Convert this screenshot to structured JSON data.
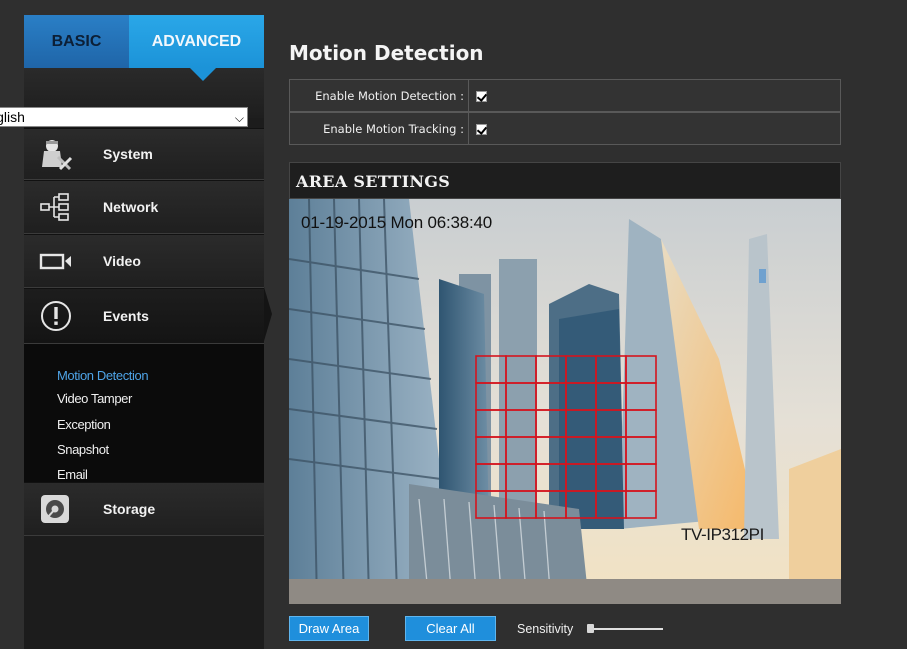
{
  "nav": {
    "tabs": [
      {
        "label": "BASIC",
        "selected": false
      },
      {
        "label": "ADVANCED",
        "selected": true
      }
    ],
    "language": "English",
    "menu": [
      {
        "key": "system",
        "label": "System",
        "icon": "user-tools-icon"
      },
      {
        "key": "network",
        "label": "Network",
        "icon": "network-tree-icon"
      },
      {
        "key": "video",
        "label": "Video",
        "icon": "video-camera-icon"
      },
      {
        "key": "events",
        "label": "Events",
        "icon": "exclamation-circle-icon",
        "expanded": true
      },
      {
        "key": "storage",
        "label": "Storage",
        "icon": "disk-icon"
      }
    ],
    "events_submenu": [
      "Motion Detection",
      "Video Tamper",
      "Exception",
      "Snapshot",
      "Email"
    ],
    "events_submenu_active": "Motion Detection"
  },
  "main": {
    "title": "Motion Detection",
    "options": [
      {
        "label": "Enable Motion Detection :",
        "checked": true
      },
      {
        "label": "Enable Motion Tracking :",
        "checked": true
      }
    ],
    "area_settings": {
      "title": "AREA SETTINGS",
      "osd_timestamp": "01-19-2015 Mon  06:38:40",
      "osd_camera_name": "TV-IP312PI",
      "grid": {
        "columns": 6,
        "rows": 6,
        "color": "#d4141e"
      }
    },
    "buttons": {
      "draw_area": "Draw Area",
      "clear_all": "Clear All"
    },
    "sensitivity": {
      "label": "Sensitivity",
      "level": 0.0
    }
  },
  "colors": {
    "accent_blue": "#1f8fdc",
    "active_submenu": "#4ea3e6",
    "background": "#2f2f2f"
  }
}
